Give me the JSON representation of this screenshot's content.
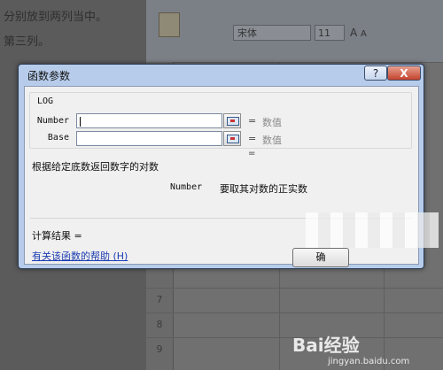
{
  "background_doc": {
    "line1": "分别放到两列当中。",
    "line2": "第三列。"
  },
  "excel": {
    "font_name": "宋体",
    "font_size": "11",
    "font_grow": "A",
    "font_shrink": "A",
    "row_numbers": [
      "7",
      "8",
      "9"
    ]
  },
  "dialog": {
    "title": "函数参数",
    "help_label": "?",
    "close_label": "X",
    "function_name": "LOG",
    "args": [
      {
        "label": "Number",
        "value": "",
        "eq": "=",
        "hint": "数值"
      },
      {
        "label": "Base",
        "value": "",
        "eq": "=",
        "hint": "数值"
      }
    ],
    "result_eq": "=",
    "description": "根据给定底数返回数字的对数",
    "arg_desc_name": "Number",
    "arg_desc_text": "要取其对数的正实数",
    "result_label": "计算结果 =",
    "help_link": "有关该函数的帮助 (H)",
    "ok_label": "确"
  },
  "watermark": {
    "brand": "Bai经验",
    "site": "jingyan.baidu.com"
  }
}
